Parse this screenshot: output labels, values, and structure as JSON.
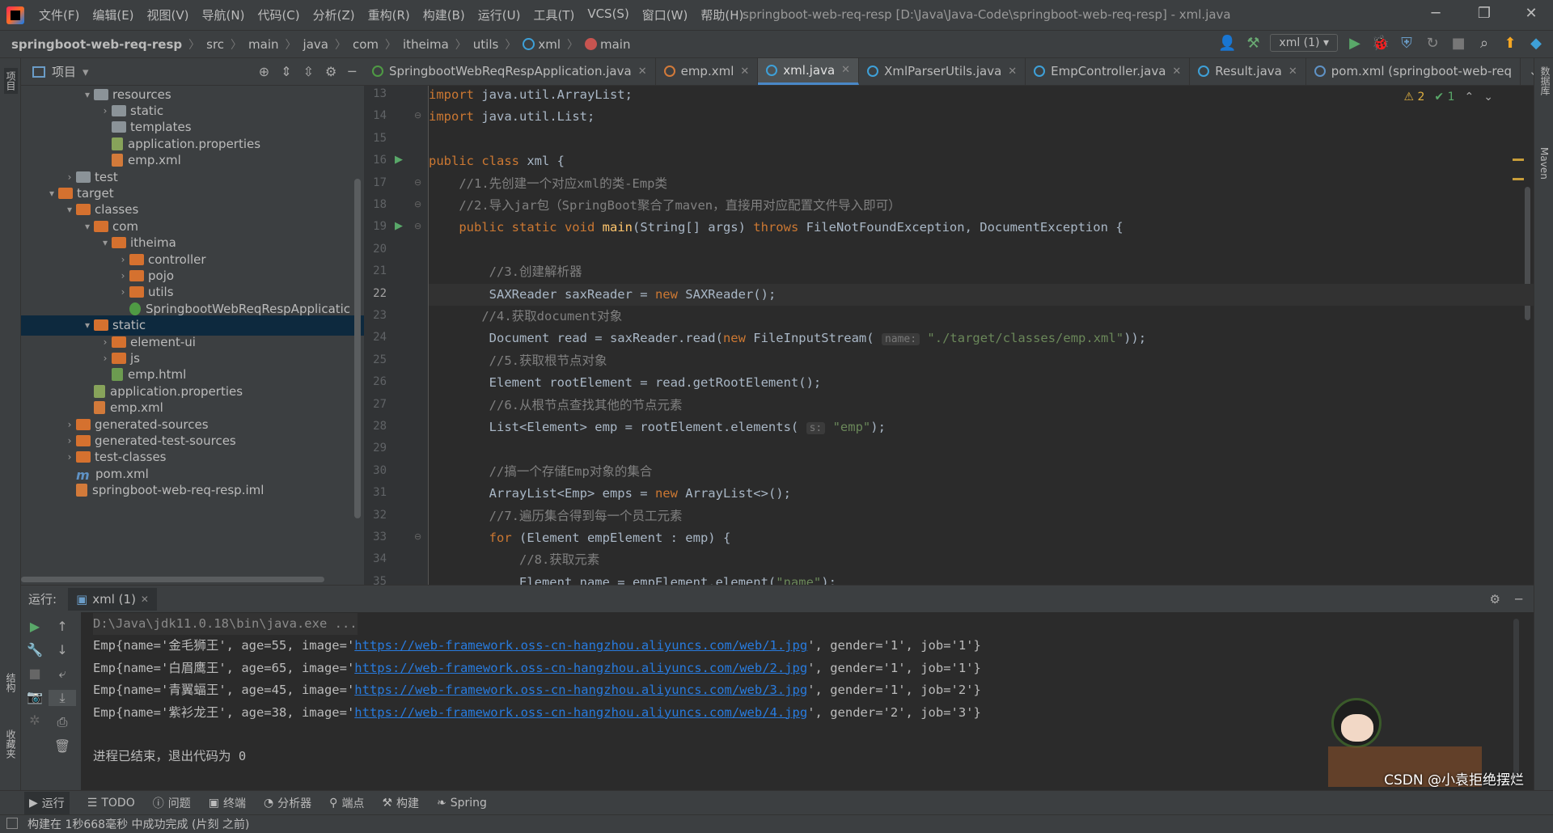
{
  "menubar": {
    "items": [
      "文件(F)",
      "编辑(E)",
      "视图(V)",
      "导航(N)",
      "代码(C)",
      "分析(Z)",
      "重构(R)",
      "构建(B)",
      "运行(U)",
      "工具(T)",
      "VCS(S)",
      "窗口(W)",
      "帮助(H)"
    ],
    "window_title": "springboot-web-req-resp [D:\\Java\\Java-Code\\springboot-web-req-resp] - xml.java"
  },
  "breadcrumb": [
    "springboot-web-req-resp",
    "src",
    "main",
    "java",
    "com",
    "itheima",
    "utils",
    "xml",
    "main"
  ],
  "run_config": "xml (1)",
  "project_panel": {
    "title": "项目",
    "side_label": "项目",
    "tree": [
      {
        "label": "resources",
        "indent": 3,
        "arrow": "▾",
        "icon": "folder-grey"
      },
      {
        "label": "static",
        "indent": 4,
        "arrow": "›",
        "icon": "folder-grey"
      },
      {
        "label": "templates",
        "indent": 4,
        "arrow": "",
        "icon": "folder-grey"
      },
      {
        "label": "application.properties",
        "indent": 4,
        "arrow": "",
        "icon": "prop"
      },
      {
        "label": "emp.xml",
        "indent": 4,
        "arrow": "",
        "icon": "xml"
      },
      {
        "label": "test",
        "indent": 2,
        "arrow": "›",
        "icon": "folder-grey"
      },
      {
        "label": "target",
        "indent": 1,
        "arrow": "▾",
        "icon": "folder-orange"
      },
      {
        "label": "classes",
        "indent": 2,
        "arrow": "▾",
        "icon": "folder-orange"
      },
      {
        "label": "com",
        "indent": 3,
        "arrow": "▾",
        "icon": "folder-orange"
      },
      {
        "label": "itheima",
        "indent": 4,
        "arrow": "▾",
        "icon": "folder-orange"
      },
      {
        "label": "controller",
        "indent": 5,
        "arrow": "›",
        "icon": "folder-orange"
      },
      {
        "label": "pojo",
        "indent": 5,
        "arrow": "›",
        "icon": "folder-orange"
      },
      {
        "label": "utils",
        "indent": 5,
        "arrow": "›",
        "icon": "folder-orange"
      },
      {
        "label": "SpringbootWebReqRespApplicatic",
        "indent": 5,
        "arrow": "",
        "icon": "spring"
      },
      {
        "label": "static",
        "indent": 3,
        "arrow": "▾",
        "icon": "folder-orange",
        "selected": true
      },
      {
        "label": "element-ui",
        "indent": 4,
        "arrow": "›",
        "icon": "folder-orange"
      },
      {
        "label": "js",
        "indent": 4,
        "arrow": "›",
        "icon": "folder-orange"
      },
      {
        "label": "emp.html",
        "indent": 4,
        "arrow": "",
        "icon": "html"
      },
      {
        "label": "application.properties",
        "indent": 3,
        "arrow": "",
        "icon": "prop"
      },
      {
        "label": "emp.xml",
        "indent": 3,
        "arrow": "",
        "icon": "xml"
      },
      {
        "label": "generated-sources",
        "indent": 2,
        "arrow": "›",
        "icon": "folder-orange"
      },
      {
        "label": "generated-test-sources",
        "indent": 2,
        "arrow": "›",
        "icon": "folder-orange"
      },
      {
        "label": "test-classes",
        "indent": 2,
        "arrow": "›",
        "icon": "folder-orange"
      },
      {
        "label": "pom.xml",
        "indent": 2,
        "arrow": "",
        "icon": "m"
      },
      {
        "label": "springboot-web-req-resp.iml",
        "indent": 2,
        "arrow": "",
        "icon": "xml"
      }
    ]
  },
  "editor_tabs": [
    {
      "label": "SpringbootWebReqRespApplication.java",
      "active": false
    },
    {
      "label": "emp.xml",
      "active": false
    },
    {
      "label": "xml.java",
      "active": true
    },
    {
      "label": "XmlParserUtils.java",
      "active": false
    },
    {
      "label": "EmpController.java",
      "active": false
    },
    {
      "label": "Result.java",
      "active": false
    },
    {
      "label": "pom.xml (springboot-web-req",
      "active": false
    }
  ],
  "inspections": {
    "warnings": "2",
    "ok": "1"
  },
  "code": {
    "current_line": 22,
    "lines": [
      {
        "n": "13",
        "html": "<span class='kw'>import</span> java.util.ArrayList;"
      },
      {
        "n": "14",
        "html": "<span class='kw'>import</span> java.util.List;"
      },
      {
        "n": "15",
        "html": ""
      },
      {
        "n": "16",
        "html": "<span class='kw'>public class</span> xml {"
      },
      {
        "n": "17",
        "html": "    <span class='cm'>//1.先创建一个对应xml的类-Emp类</span>"
      },
      {
        "n": "18",
        "html": "    <span class='cm'>//2.导入jar包（SpringBoot聚合了maven，直接用对应配置文件导入即可）</span>"
      },
      {
        "n": "19",
        "html": "    <span class='kw'>public static void</span> <span class='fn'>main</span>(String[] args) <span class='kw'>throws</span> FileNotFoundException, DocumentException {"
      },
      {
        "n": "20",
        "html": ""
      },
      {
        "n": "21",
        "html": "        <span class='cm'>//3.创建解析器</span>"
      },
      {
        "n": "22",
        "html": "        SAXReader saxReader = <span class='kw'>new</span> SAXReader();"
      },
      {
        "n": "23",
        "html": "       <span class='cm'>//4.获取document对象</span>"
      },
      {
        "n": "24",
        "html": "        Document read = saxReader.read(<span class='kw'>new</span> FileInputStream( <span class='hint'>name:</span> <span class='st'>\"./target/classes/emp.xml\"</span>));"
      },
      {
        "n": "25",
        "html": "        <span class='cm'>//5.获取根节点对象</span>"
      },
      {
        "n": "26",
        "html": "        Element rootElement = read.getRootElement();"
      },
      {
        "n": "27",
        "html": "        <span class='cm'>//6.从根节点查找其他的节点元素</span>"
      },
      {
        "n": "28",
        "html": "        List&lt;Element&gt; emp = rootElement.elements( <span class='hint'>s:</span> <span class='st'>\"emp\"</span>);"
      },
      {
        "n": "29",
        "html": ""
      },
      {
        "n": "30",
        "html": "        <span class='cm'>//搞一个存储Emp对象的集合</span>"
      },
      {
        "n": "31",
        "html": "        ArrayList&lt;Emp&gt; emps = <span class='kw'>new</span> ArrayList&lt;&gt;();"
      },
      {
        "n": "32",
        "html": "        <span class='cm'>//7.遍历集合得到每一个员工元素</span>"
      },
      {
        "n": "33",
        "html": "        <span class='kw'>for</span> (Element empElement : emp) {"
      },
      {
        "n": "34",
        "html": "            <span class='cm'>//8.获取元素</span>"
      },
      {
        "n": "35",
        "html": "            Element name = empElement.element(<span class='st'>\"name\"</span>);"
      }
    ]
  },
  "run_panel": {
    "label": "运行:",
    "tab": "xml (1)",
    "output": [
      {
        "text": "D:\\Java\\jdk11.0.18\\bin\\java.exe ...",
        "grey": true
      },
      {
        "pre": "Emp{name='金毛狮王', age=55, image='",
        "url": "https://web-framework.oss-cn-hangzhou.aliyuncs.com/web/1.jpg",
        "post": "', gender='1', job='1'}"
      },
      {
        "pre": "Emp{name='白眉鹰王', age=65, image='",
        "url": "https://web-framework.oss-cn-hangzhou.aliyuncs.com/web/2.jpg",
        "post": "', gender='1', job='1'}"
      },
      {
        "pre": "Emp{name='青翼蝠王', age=45, image='",
        "url": "https://web-framework.oss-cn-hangzhou.aliyuncs.com/web/3.jpg",
        "post": "', gender='1', job='2'}"
      },
      {
        "pre": "Emp{name='紫衫龙王', age=38, image='",
        "url": "https://web-framework.oss-cn-hangzhou.aliyuncs.com/web/4.jpg",
        "post": "', gender='2', job='3'}"
      },
      {
        "text": ""
      },
      {
        "text": "进程已结束，退出代码为 0"
      }
    ]
  },
  "bottom_tabs": [
    "运行",
    "TODO",
    "问题",
    "终端",
    "分析器",
    "端点",
    "构建",
    "Spring"
  ],
  "status": "构建在 1秒668毫秒 中成功完成 (片刻 之前)",
  "watermark": "CSDN @小袁拒绝摆烂",
  "right_stripe": [
    "数据库",
    "Maven"
  ],
  "left_stripe_bottom": [
    "结构",
    "收藏夹"
  ],
  "colors": {
    "accent": "#4a88c7",
    "selection": "#0d293e"
  }
}
